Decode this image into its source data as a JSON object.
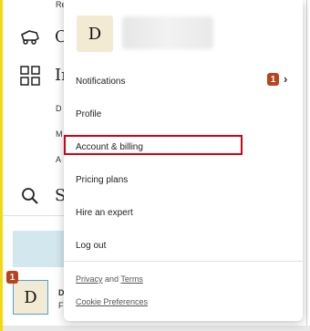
{
  "background": {
    "nav_letter_1": "C",
    "nav_letter_2": "In",
    "nav_letter_3": "S",
    "tiny_1": "Re",
    "tiny_2": "D",
    "tiny_3": "M",
    "tiny_4": "A",
    "bottom_avatar_letter": "D",
    "bottom_badge": "1",
    "bottom_text_1": "D",
    "bottom_text_2": "F"
  },
  "menu": {
    "avatar_letter": "D",
    "items": [
      {
        "label": "Notifications",
        "badge": "1"
      },
      {
        "label": "Profile"
      },
      {
        "label": "Account & billing"
      },
      {
        "label": "Pricing plans"
      },
      {
        "label": "Hire an expert"
      },
      {
        "label": "Log out"
      }
    ],
    "footer": {
      "privacy": "Privacy",
      "and": "and",
      "terms": "Terms",
      "cookie": "Cookie Preferences"
    }
  },
  "colors": {
    "accent_yellow": "#f5d90a",
    "badge": "#b8431c",
    "highlight": "#d0021b"
  }
}
